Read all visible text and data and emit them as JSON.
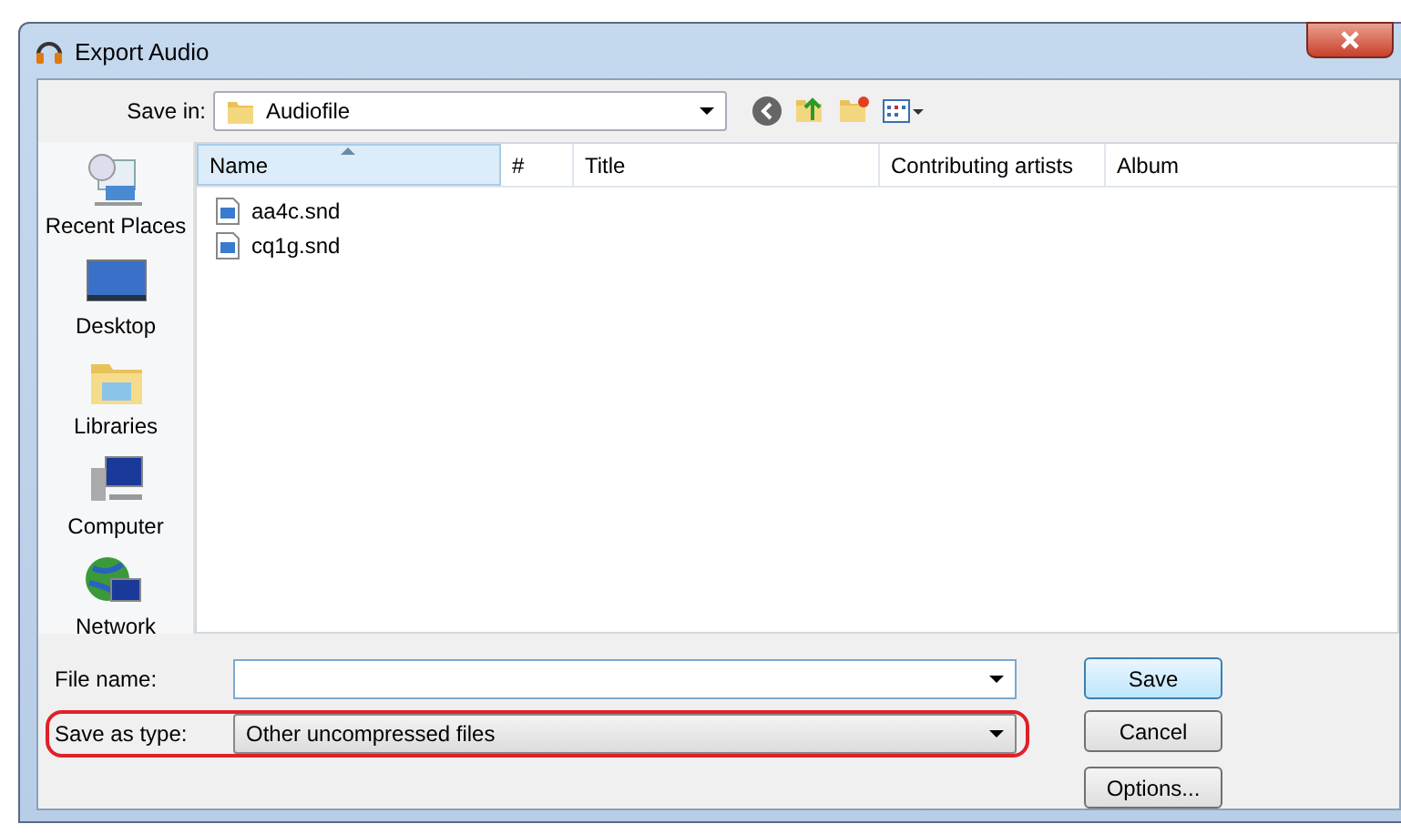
{
  "window": {
    "title": "Export Audio"
  },
  "save_in": {
    "label": "Save in:",
    "value": "Audiofile"
  },
  "places": [
    {
      "label": "Recent Places",
      "kind": "recent"
    },
    {
      "label": "Desktop",
      "kind": "desktop"
    },
    {
      "label": "Libraries",
      "kind": "libraries"
    },
    {
      "label": "Computer",
      "kind": "computer"
    },
    {
      "label": "Network",
      "kind": "network"
    }
  ],
  "columns": [
    {
      "label": "Name",
      "sorted": true
    },
    {
      "label": "#",
      "sorted": false
    },
    {
      "label": "Title",
      "sorted": false
    },
    {
      "label": "Contributing artists",
      "sorted": false
    },
    {
      "label": "Album",
      "sorted": false
    }
  ],
  "files": [
    {
      "name": "aa4c.snd"
    },
    {
      "name": "cq1g.snd"
    }
  ],
  "file_name": {
    "label": "File name:"
  },
  "save_as_type": {
    "label": "Save as type:",
    "value": "Other uncompressed files",
    "highlighted": true
  },
  "buttons": [
    {
      "label": "Save",
      "default": true
    },
    {
      "label": "Cancel",
      "default": false
    },
    {
      "label": "Options...",
      "default": false
    }
  ]
}
